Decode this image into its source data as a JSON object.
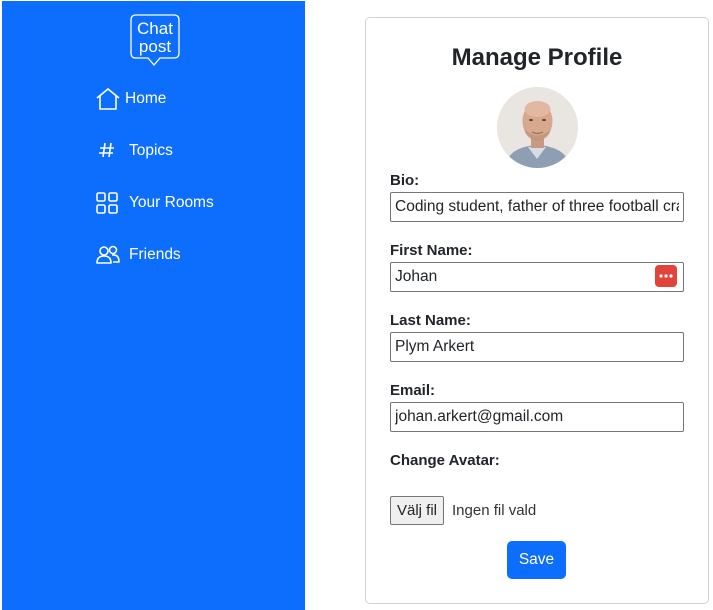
{
  "app": {
    "logo_line1": "Chat",
    "logo_line2": "post"
  },
  "sidebar": {
    "items": [
      {
        "label": "Home",
        "icon": "house-icon"
      },
      {
        "label": "Topics",
        "icon": "hash-icon"
      },
      {
        "label": "Your Rooms",
        "icon": "grid-icon"
      },
      {
        "label": "Friends",
        "icon": "people-icon"
      }
    ]
  },
  "profile": {
    "title": "Manage Profile",
    "bio_label": "Bio:",
    "bio_value": "Coding student, father of three football crazy kids",
    "first_name_label": "First Name:",
    "first_name_value": "Johan",
    "last_name_label": "Last Name:",
    "last_name_value": "Plym Arkert",
    "email_label": "Email:",
    "email_value": "johan.arkert@gmail.com",
    "avatar_label": "Change Avatar:",
    "file_button": "Välj fil",
    "file_status": "Ingen fil vald",
    "save_label": "Save"
  },
  "colors": {
    "primary": "#0d6efd",
    "password_manager": "#e0443b"
  }
}
